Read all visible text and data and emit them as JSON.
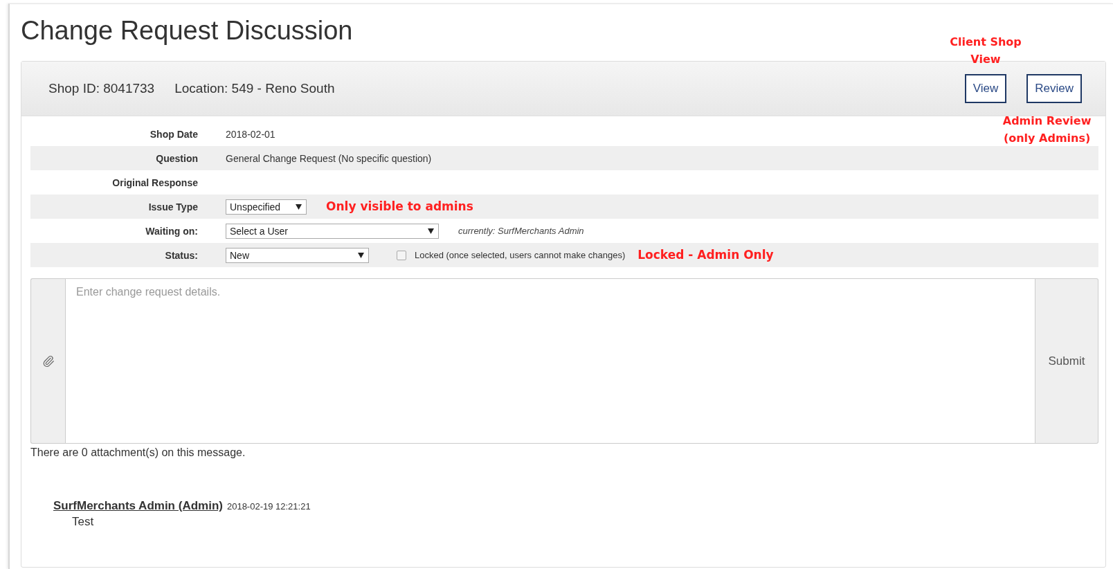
{
  "title": "Change Request Discussion",
  "header": {
    "shop_id": "Shop ID: 8041733",
    "location": "Location: 549 - Reno South",
    "buttons": [
      {
        "label": "View",
        "annotation_above": "Client Shop View"
      },
      {
        "label": "Review",
        "annotation_below": "Admin Review (only Admins)"
      }
    ]
  },
  "fields": [
    {
      "label": "Shop Date",
      "kind": "text",
      "value": "2018-02-01"
    },
    {
      "label": "Question",
      "kind": "text",
      "value": "General Change Request (No specific question)"
    },
    {
      "label": "Original Response",
      "kind": "text"
    },
    {
      "label": "Issue Type",
      "kind": "select",
      "value": "Unspecified",
      "annotation": "Only visible to admins"
    },
    {
      "label": "Waiting on:",
      "kind": "select",
      "value": "Select a User",
      "note": "currently: SurfMerchants Admin"
    },
    {
      "label": "Status:",
      "kind": "select",
      "value": "New",
      "checkbox": {
        "label": "Locked (once selected, users cannot make changes)",
        "checked": false
      },
      "annotation": "Locked - Admin Only"
    }
  ],
  "editor": {
    "placeholder": "Enter change request details.",
    "submit": "Submit"
  },
  "attachments_text": "There are 0 attachment(s) on this message.",
  "messages": [
    {
      "author": "SurfMerchants Admin (Admin)",
      "time": "2018-02-19 12:21:21",
      "body": "Test"
    }
  ]
}
